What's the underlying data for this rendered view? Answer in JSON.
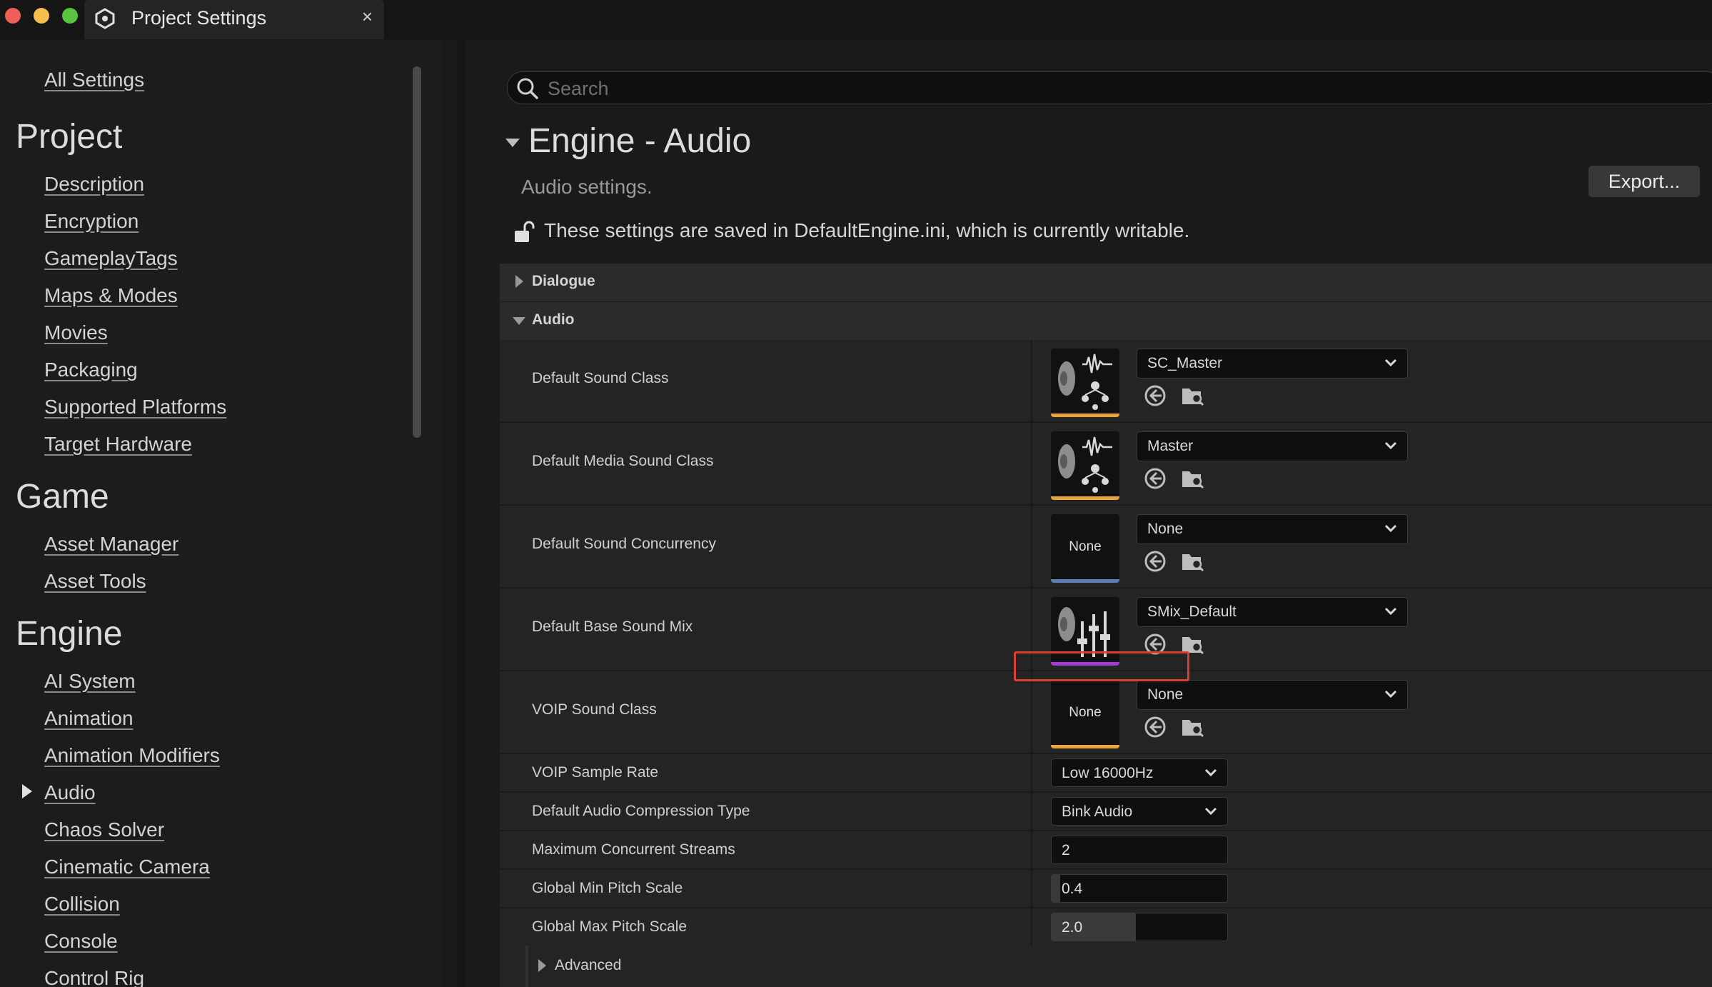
{
  "window": {
    "tab_title": "Project Settings",
    "close_glyph": "×",
    "colors": {
      "close": "#ee5f57",
      "minimize": "#f5be4f",
      "maximize": "#58c43f"
    }
  },
  "sidebar": {
    "all_settings": "All Settings",
    "groups": [
      {
        "heading": "Project",
        "items": [
          "Description",
          "Encryption",
          "GameplayTags",
          "Maps & Modes",
          "Movies",
          "Packaging",
          "Supported Platforms",
          "Target Hardware"
        ]
      },
      {
        "heading": "Game",
        "items": [
          "Asset Manager",
          "Asset Tools"
        ]
      },
      {
        "heading": "Engine",
        "items": [
          "AI System",
          "Animation",
          "Animation Modifiers",
          "Audio",
          "Chaos Solver",
          "Cinematic Camera",
          "Collision",
          "Console",
          "Control Rig"
        ]
      }
    ],
    "selected_item": "Audio"
  },
  "search": {
    "placeholder": "Search"
  },
  "section": {
    "title": "Engine - Audio",
    "description": "Audio settings.",
    "export_label": "Export...",
    "writable_note": "These settings are saved in DefaultEngine.ini, which is currently writable."
  },
  "categories": {
    "dialogue": "Dialogue",
    "audio": "Audio",
    "advanced": "Advanced"
  },
  "properties": {
    "default_sound_class": {
      "label": "Default Sound Class",
      "value": "SC_Master",
      "thumb_accent": "#e8a33a"
    },
    "default_media_sound_class": {
      "label": "Default Media Sound Class",
      "value": "Master",
      "thumb_accent": "#e8a33a"
    },
    "default_sound_concurrency": {
      "label": "Default Sound Concurrency",
      "value": "None",
      "thumb_text": "None",
      "thumb_accent": "#5c7fb8"
    },
    "default_base_sound_mix": {
      "label": "Default Base Sound Mix",
      "value": "SMix_Default",
      "thumb_accent": "#a23ad6"
    },
    "voip_sound_class": {
      "label": "VOIP Sound Class",
      "value": "None",
      "thumb_text": "None",
      "thumb_accent": "#e8a33a"
    },
    "voip_sample_rate": {
      "label": "VOIP Sample Rate",
      "value": "Low 16000Hz"
    },
    "default_audio_compression_type": {
      "label": "Default Audio Compression Type",
      "value": "Bink Audio"
    },
    "maximum_concurrent_streams": {
      "label": "Maximum Concurrent Streams",
      "value": "2"
    },
    "global_min_pitch_scale": {
      "label": "Global Min Pitch Scale",
      "value": "0.4",
      "slider_fraction": 0.05
    },
    "global_max_pitch_scale": {
      "label": "Global Max Pitch Scale",
      "value": "2.0",
      "slider_fraction": 0.48
    }
  },
  "highlight_color": "#d8412f"
}
